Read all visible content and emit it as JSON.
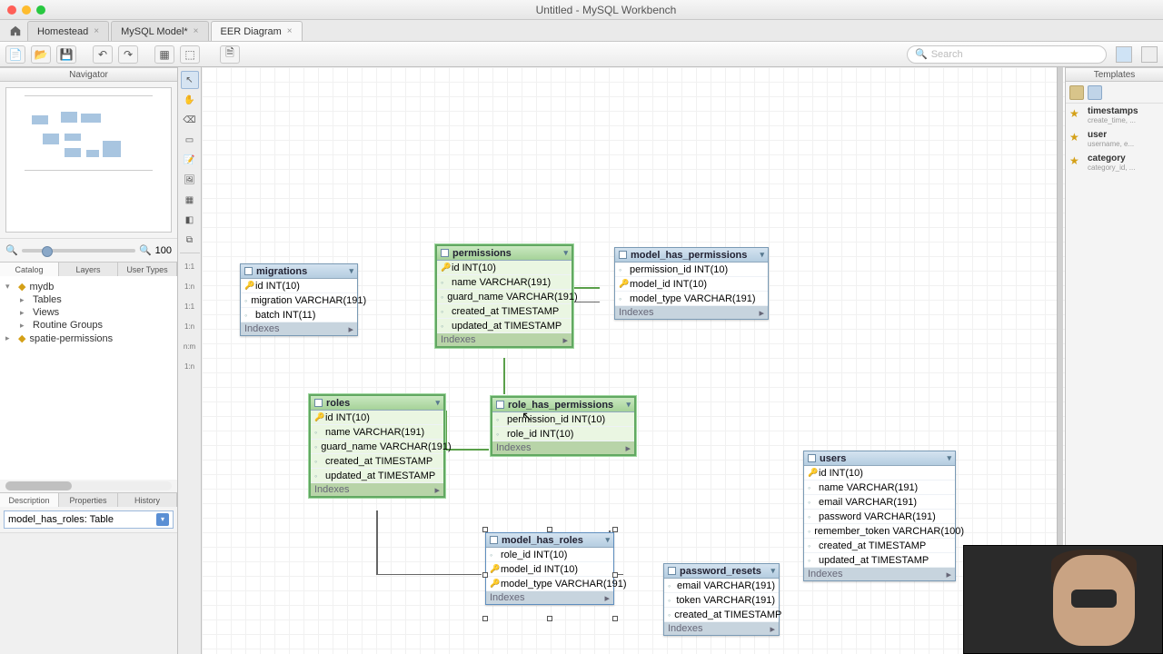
{
  "window": {
    "title": "Untitled - MySQL Workbench"
  },
  "tabs": [
    {
      "label": "Homestead",
      "active": false
    },
    {
      "label": "MySQL Model*",
      "active": false
    },
    {
      "label": "EER Diagram",
      "active": true
    }
  ],
  "search": {
    "placeholder": "Search"
  },
  "zoom": {
    "value": "100"
  },
  "left_panel": {
    "navigator": "Navigator"
  },
  "section_tabs": [
    "Catalog",
    "Layers",
    "User Types"
  ],
  "tree": {
    "db1": "mydb",
    "db1_children": [
      "Tables",
      "Views",
      "Routine Groups"
    ],
    "db2": "spatie-permissions"
  },
  "desc_tabs": [
    "Description",
    "Properties",
    "History"
  ],
  "desc_value": "model_has_roles: Table",
  "right_panel": {
    "header": "Templates"
  },
  "templates": [
    {
      "name": "timestamps",
      "sub": "create_time, ..."
    },
    {
      "name": "user",
      "sub": "username, e..."
    },
    {
      "name": "category",
      "sub": "category_id, ..."
    }
  ],
  "tables": {
    "migrations": {
      "title": "migrations",
      "cols": [
        "id INT(10)",
        "migration VARCHAR(191)",
        "batch INT(11)"
      ],
      "idx": "Indexes"
    },
    "permissions": {
      "title": "permissions",
      "cols": [
        "id INT(10)",
        "name VARCHAR(191)",
        "guard_name VARCHAR(191)",
        "created_at TIMESTAMP",
        "updated_at TIMESTAMP"
      ],
      "idx": "Indexes"
    },
    "model_has_permissions": {
      "title": "model_has_permissions",
      "cols": [
        "permission_id INT(10)",
        "model_id INT(10)",
        "model_type VARCHAR(191)"
      ],
      "idx": "Indexes"
    },
    "roles": {
      "title": "roles",
      "cols": [
        "id INT(10)",
        "name VARCHAR(191)",
        "guard_name VARCHAR(191)",
        "created_at TIMESTAMP",
        "updated_at TIMESTAMP"
      ],
      "idx": "Indexes"
    },
    "role_has_permissions": {
      "title": "role_has_permissions",
      "cols": [
        "permission_id INT(10)",
        "role_id INT(10)"
      ],
      "idx": "Indexes"
    },
    "model_has_roles": {
      "title": "model_has_roles",
      "cols": [
        "role_id INT(10)",
        "model_id INT(10)",
        "model_type VARCHAR(191)"
      ],
      "idx": "Indexes"
    },
    "password_resets": {
      "title": "password_resets",
      "cols": [
        "email VARCHAR(191)",
        "token VARCHAR(191)",
        "created_at TIMESTAMP"
      ],
      "idx": "Indexes"
    },
    "users": {
      "title": "users",
      "cols": [
        "id INT(10)",
        "name VARCHAR(191)",
        "email VARCHAR(191)",
        "password VARCHAR(191)",
        "remember_token VARCHAR(100)",
        "created_at TIMESTAMP",
        "updated_at TIMESTAMP"
      ],
      "idx": "Indexes"
    }
  }
}
